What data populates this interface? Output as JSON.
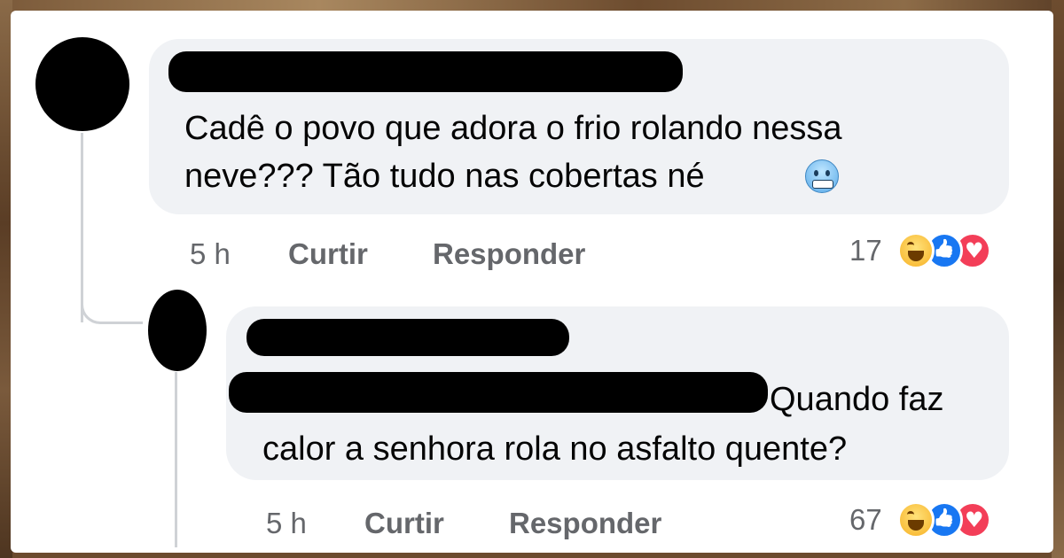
{
  "comment": {
    "text_line1": "Cadê o povo que adora o frio rolando nessa",
    "text_line2": "neve??? Tão tudo nas cobertas né",
    "emoji": "cold-face-emoji",
    "time": "5 h",
    "like_label": "Curtir",
    "reply_label": "Responder",
    "reaction_count": "17",
    "reactions": [
      "haha-icon",
      "like-icon",
      "love-icon"
    ]
  },
  "reply": {
    "text_line1": "Quando faz",
    "text_line2": "calor a senhora rola no asfalto quente?",
    "time": "5 h",
    "like_label": "Curtir",
    "reply_label": "Responder",
    "reaction_count": "67",
    "reactions": [
      "haha-icon",
      "like-icon",
      "love-icon"
    ]
  },
  "colors": {
    "bubble": "#f0f2f5",
    "meta_text": "#65676b",
    "like_blue": "#1877f2",
    "love_red": "#f33e58",
    "haha_yellow": "#f7b125"
  }
}
